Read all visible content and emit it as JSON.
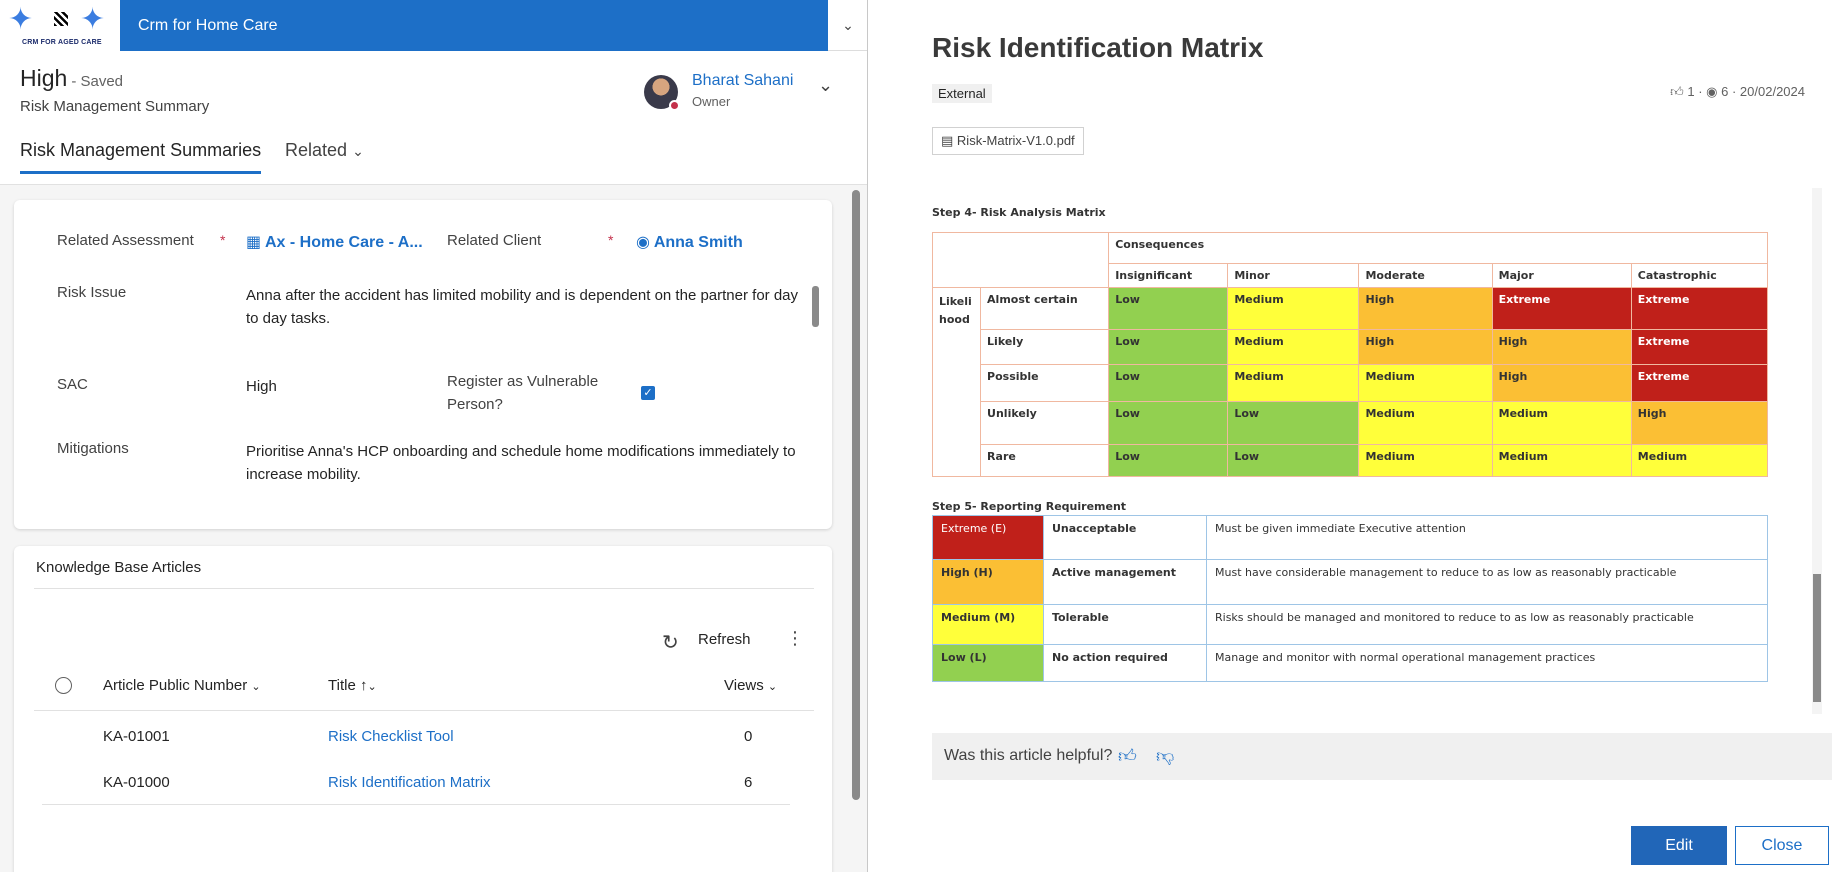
{
  "app": {
    "title": "Crm for Home Care",
    "logo_text": "CRM FOR AGED CARE"
  },
  "record": {
    "title": "High",
    "saved": "- Saved",
    "entity": "Risk Management Summary",
    "owner": {
      "name": "Bharat Sahani",
      "role": "Owner"
    }
  },
  "tabs": [
    "Risk Management Summaries",
    "Related"
  ],
  "form": {
    "related_assessment_label": "Related Assessment",
    "related_assessment_value": "Ax - Home Care - A...",
    "related_client_label": "Related Client",
    "related_client_value": "Anna Smith",
    "risk_issue_label": "Risk Issue",
    "risk_issue_value": "Anna after the accident has limited mobility and is dependent on the partner for day to day tasks.",
    "sac_label": "SAC",
    "sac_value": "High",
    "vulnerable_label": "Register as Vulnerable Person?",
    "mitigations_label": "Mitigations",
    "mitigations_value": "Prioritise Anna's HCP onboarding and schedule home modifications immediately to increase mobility."
  },
  "kb": {
    "title": "Knowledge Base Articles",
    "refresh": "Refresh",
    "columns": [
      "Article Public Number",
      "Title",
      "Views"
    ],
    "rows": [
      {
        "number": "KA-01001",
        "title": "Risk Checklist Tool",
        "views": "0"
      },
      {
        "number": "KA-01000",
        "title": "Risk Identification Matrix",
        "views": "6"
      }
    ]
  },
  "article": {
    "title": "Risk Identification Matrix",
    "tag": "External",
    "likes": "1",
    "views": "6",
    "date": "20/02/2024",
    "attachment": "Risk-Matrix-V1.0.pdf",
    "step4": "Step 4- Risk Analysis Matrix",
    "step5": "Step 5- Reporting Requirement",
    "consequences": "Consequences",
    "likelihood": "Likeli hood",
    "cons_cols": [
      "Insignificant",
      "Minor",
      "Moderate",
      "Major",
      "Catastrophic"
    ],
    "matrix": [
      {
        "label": "Almost certain",
        "cells": [
          "Low",
          "Medium",
          "High",
          "Extreme",
          "Extreme"
        ]
      },
      {
        "label": "Likely",
        "cells": [
          "Low",
          "Medium",
          "High",
          "High",
          "Extreme"
        ]
      },
      {
        "label": "Possible",
        "cells": [
          "Low",
          "Medium",
          "Medium",
          "High",
          "Extreme"
        ]
      },
      {
        "label": "Unlikely",
        "cells": [
          "Low",
          "Low",
          "Medium",
          "Medium",
          "High"
        ]
      },
      {
        "label": "Rare",
        "cells": [
          "Low",
          "Low",
          "Medium",
          "Medium",
          "Medium"
        ]
      }
    ],
    "reporting": [
      {
        "level": "Extreme (E)",
        "action": "Unacceptable",
        "desc": "Must be given immediate Executive attention"
      },
      {
        "level": "High (H)",
        "action": "Active management",
        "desc": "Must have considerable management to reduce to as low as reasonably practicable"
      },
      {
        "level": "Medium (M)",
        "action": "Tolerable",
        "desc": "Risks should be managed and monitored to reduce to as low as reasonably practicable"
      },
      {
        "level": "Low (L)",
        "action": "No action required",
        "desc": "Manage and monitor with normal operational management practices"
      }
    ],
    "helpful": "Was this article helpful?",
    "edit": "Edit",
    "close": "Close"
  }
}
